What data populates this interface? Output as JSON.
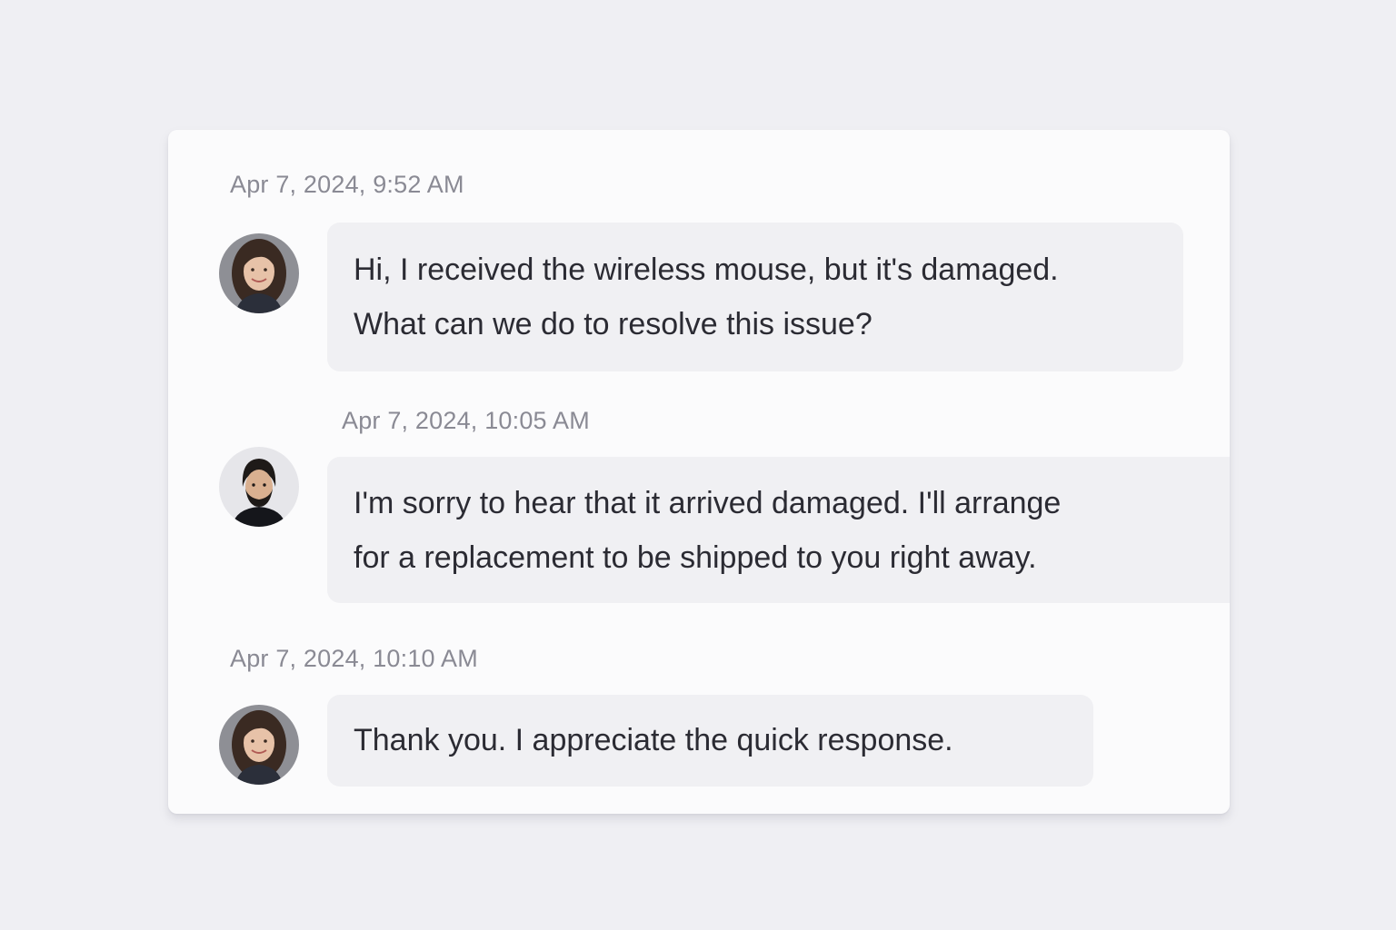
{
  "messages": [
    {
      "timestamp": "Apr 7, 2024, 9:52 AM",
      "sender_role": "customer",
      "avatar_icon": "woman-avatar-icon",
      "lines": [
        "Hi, I received the wireless mouse, but it's damaged.",
        "What can we do to resolve this issue?"
      ]
    },
    {
      "timestamp": "Apr 7, 2024, 10:05 AM",
      "sender_role": "agent",
      "avatar_icon": "man-avatar-icon",
      "lines": [
        "I'm sorry to hear that it arrived damaged. I'll arrange",
        "for a replacement to be shipped to you right away."
      ]
    },
    {
      "timestamp": "Apr 7, 2024, 10:10 AM",
      "sender_role": "customer",
      "avatar_icon": "woman-avatar-icon",
      "lines": [
        "Thank you. I appreciate the quick response."
      ]
    }
  ],
  "colors": {
    "page_background": "#efeff3",
    "card_background": "#fbfbfc",
    "bubble_background": "#f0f0f3",
    "timestamp_text": "#8a8a94",
    "message_text": "#2b2b33"
  }
}
